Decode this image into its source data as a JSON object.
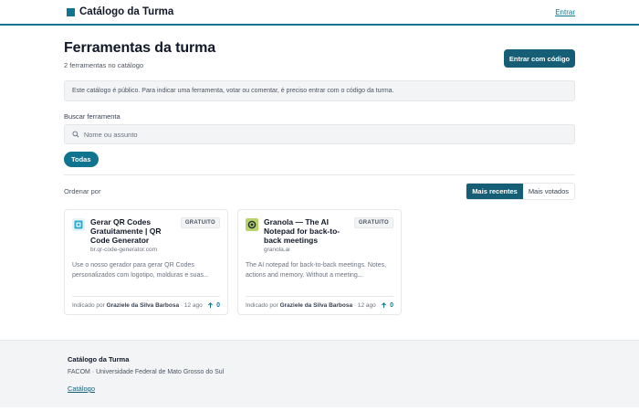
{
  "header": {
    "brand": "Catálogo da Turma",
    "login_link": "Entrar"
  },
  "page": {
    "title": "Ferramentas da turma",
    "subtitle": "2 ferramentas no catálogo",
    "code_button": "Entrar com código",
    "notice": "Este catálogo é público. Para indicar uma ferramenta, votar ou comentar, é preciso entrar com o código da turma."
  },
  "search": {
    "label": "Buscar ferramenta",
    "placeholder": "Nome ou assunto",
    "value": ""
  },
  "filters": {
    "all": "Todas"
  },
  "sort": {
    "label": "Ordenar por",
    "recent": "Mais recentes",
    "voted": "Mais votados",
    "selected": "Mais recentes"
  },
  "cards": [
    {
      "title": "Gerar QR Codes Gratuitamente | QR Code Generator",
      "domain": "br.qr-code-generator.com",
      "badge": "GRATUITO",
      "description": "Use o nosso gerador para gerar QR Codes personalizados com logotipo, molduras e suas...",
      "indicated_by": "Indicado por",
      "author": "Graziele da Silva Barbosa",
      "time": "· 12 ago",
      "votes": "0",
      "icon": "qr-code-icon",
      "icon_color": "#2aa9d2"
    },
    {
      "title": "Granola — The AI Notepad for back-to-back meetings",
      "domain": "granola.ai",
      "badge": "GRATUITO",
      "description": "The AI notepad for back-to-back meetings. Notes, actions and memory. Without a meeting...",
      "indicated_by": "Indicado por",
      "author": "Graziele da Silva Barbosa",
      "time": "· 12 ago",
      "votes": "0",
      "icon": "granola-logo-icon",
      "icon_color": "#b7d36a"
    }
  ],
  "footer": {
    "title": "Catálogo da Turma",
    "org": "FACOM · Universidade Federal de Mato Grosso do Sul",
    "link": "Catálogo"
  },
  "colors": {
    "accent": "#0e7490",
    "accent_dark": "#155e75"
  }
}
